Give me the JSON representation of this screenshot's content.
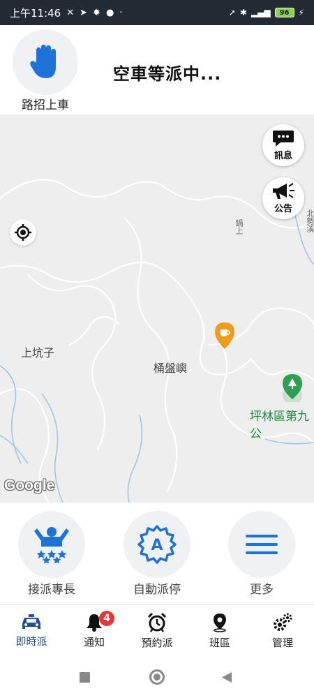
{
  "status_bar": {
    "time": "上午11:46",
    "battery": "96"
  },
  "header": {
    "hail_label": "路招上車",
    "status_title": "空車等派中..."
  },
  "map": {
    "messages_label": "訊息",
    "announcement_label": "公告",
    "places": {
      "shangkengzi": "上坑子",
      "tongpanyu": "桶盤嶼",
      "pinglin": "坪林區第九公",
      "road": "鍋上",
      "north": "北勢溪"
    },
    "attribution": "Google"
  },
  "actions": [
    {
      "label": "接派專長"
    },
    {
      "label": "自動派停"
    },
    {
      "label": "更多"
    }
  ],
  "nav": {
    "items": [
      {
        "label": "即時派"
      },
      {
        "label": "通知",
        "badge": "4"
      },
      {
        "label": "預約派"
      },
      {
        "label": "班區"
      },
      {
        "label": "管理"
      }
    ]
  },
  "colors": {
    "accent_blue": "#1e73d8",
    "active_nav": "#1e4e9c",
    "badge_red": "#e53935",
    "map_bg": "#eeeeee"
  }
}
